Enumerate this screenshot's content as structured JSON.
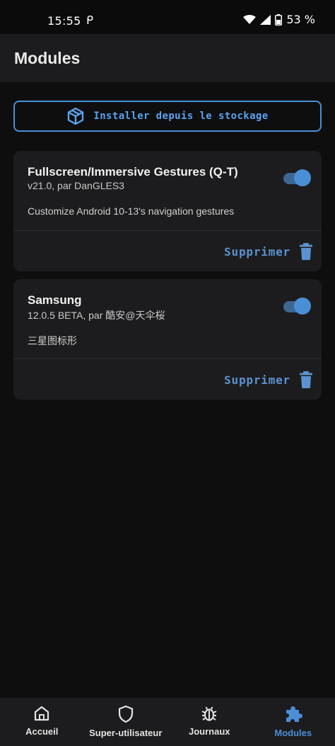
{
  "status_bar": {
    "time": "15:55",
    "notification_glyph": "ᑭ",
    "battery_percent": "53 %"
  },
  "app_bar": {
    "title": "Modules"
  },
  "install_button": {
    "label": "Installer depuis le stockage",
    "icon": "package-icon"
  },
  "modules": [
    {
      "name": "Fullscreen/Immersive Gestures (Q-T)",
      "version": "v21.0, par DanGLES3",
      "description": "Customize Android 10-13's navigation gestures",
      "enabled": true,
      "delete_label": "Supprimer"
    },
    {
      "name": "Samsung",
      "version": "12.0.5 BETA, par 酷安@天伞桜",
      "description": "三星图标形",
      "enabled": true,
      "delete_label": "Supprimer"
    }
  ],
  "bottom_nav": [
    {
      "label": "Accueil",
      "icon": "home-icon",
      "active": false
    },
    {
      "label": "Super-utilisateur",
      "icon": "shield-icon",
      "active": false
    },
    {
      "label": "Journaux",
      "icon": "bug-icon",
      "active": false
    },
    {
      "label": "Modules",
      "icon": "puzzle-icon",
      "active": true
    }
  ],
  "colors": {
    "accent": "#4a8fd6",
    "background": "#0e0e0f",
    "surface": "#1c1c1e"
  }
}
